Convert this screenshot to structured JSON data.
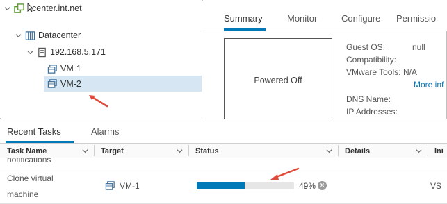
{
  "tree": {
    "vcenter": "center.int.net",
    "datacenter": "Datacenter",
    "host": "192.168.5.171",
    "vm1": "VM-1",
    "vm2": "VM-2"
  },
  "tabs": [
    "Summary",
    "Monitor",
    "Configure",
    "Permissio"
  ],
  "vm_summary": {
    "power_state": "Powered Off",
    "guest_os_label": "Guest OS:",
    "guest_os_value": "null",
    "compatibility_label": "Compatibility:",
    "vmware_tools_label": "VMware Tools:",
    "vmware_tools_value": "N/A",
    "more_info_link": "More inf",
    "dns_name_label": "DNS Name:",
    "ip_addresses_label": "IP Addresses:"
  },
  "bottom_tabs": [
    "Recent Tasks",
    "Alarms"
  ],
  "table": {
    "headers": [
      "Task Name",
      "Target",
      "Status",
      "Details",
      "Ini"
    ],
    "partial_row_task": "notifications",
    "row": {
      "task_line1": "Clone virtual",
      "task_line2": "machine",
      "target": "VM-1",
      "progress_percent": 49,
      "progress_label": "49%",
      "initiator_partial": "VS"
    }
  },
  "colors": {
    "accent": "#0079b8",
    "selected": "#d6e6f2",
    "annotation_arrow": "#e04a3a"
  },
  "icons": [
    "vcenter-icon",
    "datacenter-icon",
    "host-icon",
    "vm-icon",
    "chevron-down-icon",
    "cancel-icon",
    "cursor-icon"
  ]
}
